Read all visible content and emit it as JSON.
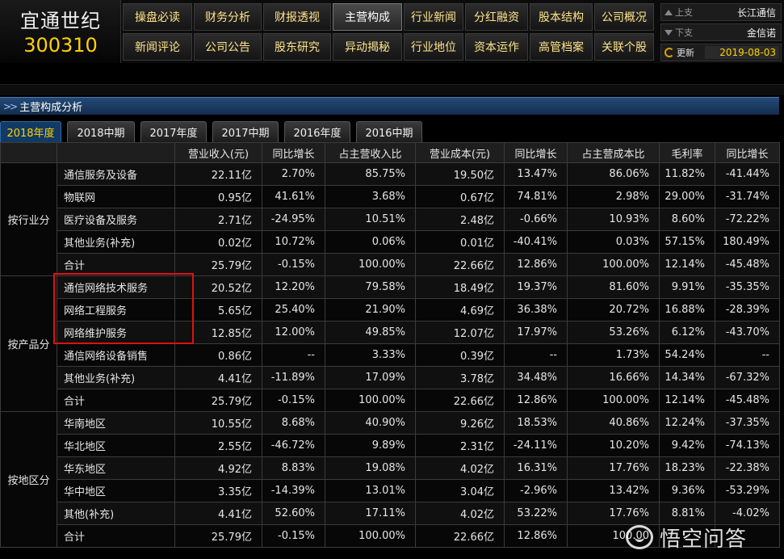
{
  "stock": {
    "name": "宜通世纪",
    "code": "300310"
  },
  "nav": {
    "row1": [
      "操盘必读",
      "财务分析",
      "财报透视",
      "主营构成",
      "行业新闻",
      "分红融资",
      "股本结构",
      "公司概况"
    ],
    "row2": [
      "新闻评论",
      "公司公告",
      "股东研究",
      "异动揭秘",
      "行业地位",
      "资本运作",
      "高管档案",
      "关联个股"
    ],
    "active": "主营构成"
  },
  "side": {
    "prev_label": "上支",
    "prev_value": "长江通信",
    "next_label": "下支",
    "next_value": "金信诺",
    "update_label": "更新",
    "update_value": "2019-08-03"
  },
  "section_title": "主营构成分析",
  "tabs": [
    "2018年度",
    "2018中期",
    "2017年度",
    "2017中期",
    "2016年度",
    "2016中期"
  ],
  "active_tab": "2018年度",
  "table": {
    "headers": [
      "",
      "",
      "营业收入(元)",
      "同比增长",
      "占主营收入比",
      "营业成本(元)",
      "同比增长",
      "占主营成本比",
      "毛利率",
      "同比增长"
    ],
    "groups": [
      {
        "label": "按行业分",
        "rows": [
          [
            "通信服务及设备",
            "22.11亿",
            "2.70%",
            "85.75%",
            "19.50亿",
            "13.47%",
            "86.06%",
            "11.82%",
            "-41.44%"
          ],
          [
            "物联网",
            "0.95亿",
            "41.61%",
            "3.68%",
            "0.67亿",
            "74.81%",
            "2.98%",
            "29.00%",
            "-31.74%"
          ],
          [
            "医疗设备及服务",
            "2.71亿",
            "-24.95%",
            "10.51%",
            "2.48亿",
            "-0.66%",
            "10.93%",
            "8.60%",
            "-72.22%"
          ],
          [
            "其他业务(补充)",
            "0.02亿",
            "10.72%",
            "0.06%",
            "0.01亿",
            "-40.41%",
            "0.03%",
            "57.15%",
            "180.49%"
          ],
          [
            "合计",
            "25.79亿",
            "-0.15%",
            "100.00%",
            "22.66亿",
            "12.86%",
            "100.00%",
            "12.14%",
            "-45.48%"
          ]
        ]
      },
      {
        "label": "按产品分",
        "rows": [
          [
            "通信网络技术服务",
            "20.52亿",
            "12.20%",
            "79.58%",
            "18.49亿",
            "19.37%",
            "81.60%",
            "9.91%",
            "-35.35%"
          ],
          [
            "网络工程服务",
            "5.65亿",
            "25.40%",
            "21.90%",
            "4.69亿",
            "36.38%",
            "20.72%",
            "16.88%",
            "-28.39%"
          ],
          [
            "网络维护服务",
            "12.85亿",
            "12.00%",
            "49.85%",
            "12.07亿",
            "17.97%",
            "53.26%",
            "6.12%",
            "-43.70%"
          ],
          [
            "通信网络设备销售",
            "0.86亿",
            "--",
            "3.33%",
            "0.39亿",
            "--",
            "1.73%",
            "54.24%",
            "--"
          ],
          [
            "其他业务(补充)",
            "4.41亿",
            "-11.89%",
            "17.09%",
            "3.78亿",
            "34.48%",
            "16.66%",
            "14.34%",
            "-67.32%"
          ],
          [
            "合计",
            "25.79亿",
            "-0.15%",
            "100.00%",
            "22.66亿",
            "12.86%",
            "100.00%",
            "12.14%",
            "-45.48%"
          ]
        ]
      },
      {
        "label": "按地区分",
        "rows": [
          [
            "华南地区",
            "10.55亿",
            "8.68%",
            "40.90%",
            "9.26亿",
            "18.53%",
            "40.86%",
            "12.24%",
            "-37.35%"
          ],
          [
            "华北地区",
            "2.55亿",
            "-46.72%",
            "9.89%",
            "2.31亿",
            "-24.11%",
            "10.20%",
            "9.42%",
            "-74.13%"
          ],
          [
            "华东地区",
            "4.92亿",
            "8.83%",
            "19.08%",
            "4.02亿",
            "16.31%",
            "17.76%",
            "18.23%",
            "-22.38%"
          ],
          [
            "华中地区",
            "3.35亿",
            "-14.39%",
            "13.01%",
            "3.04亿",
            "-2.96%",
            "13.42%",
            "9.36%",
            "-53.29%"
          ],
          [
            "其他(补充)",
            "4.41亿",
            "52.60%",
            "17.11%",
            "4.02亿",
            "53.22%",
            "17.76%",
            "8.81%",
            "-4.02%"
          ],
          [
            "合计",
            "25.79亿",
            "-0.15%",
            "100.00%",
            "22.66亿",
            "12.86%",
            "100.00",
            "",
            ""
          ]
        ]
      }
    ]
  },
  "watermark": "悟空问答",
  "colors": {
    "accent": "#ffd200",
    "nav_text": "#ffe48a",
    "section_bar": "#1b3a62",
    "highlight": "#d11111"
  }
}
